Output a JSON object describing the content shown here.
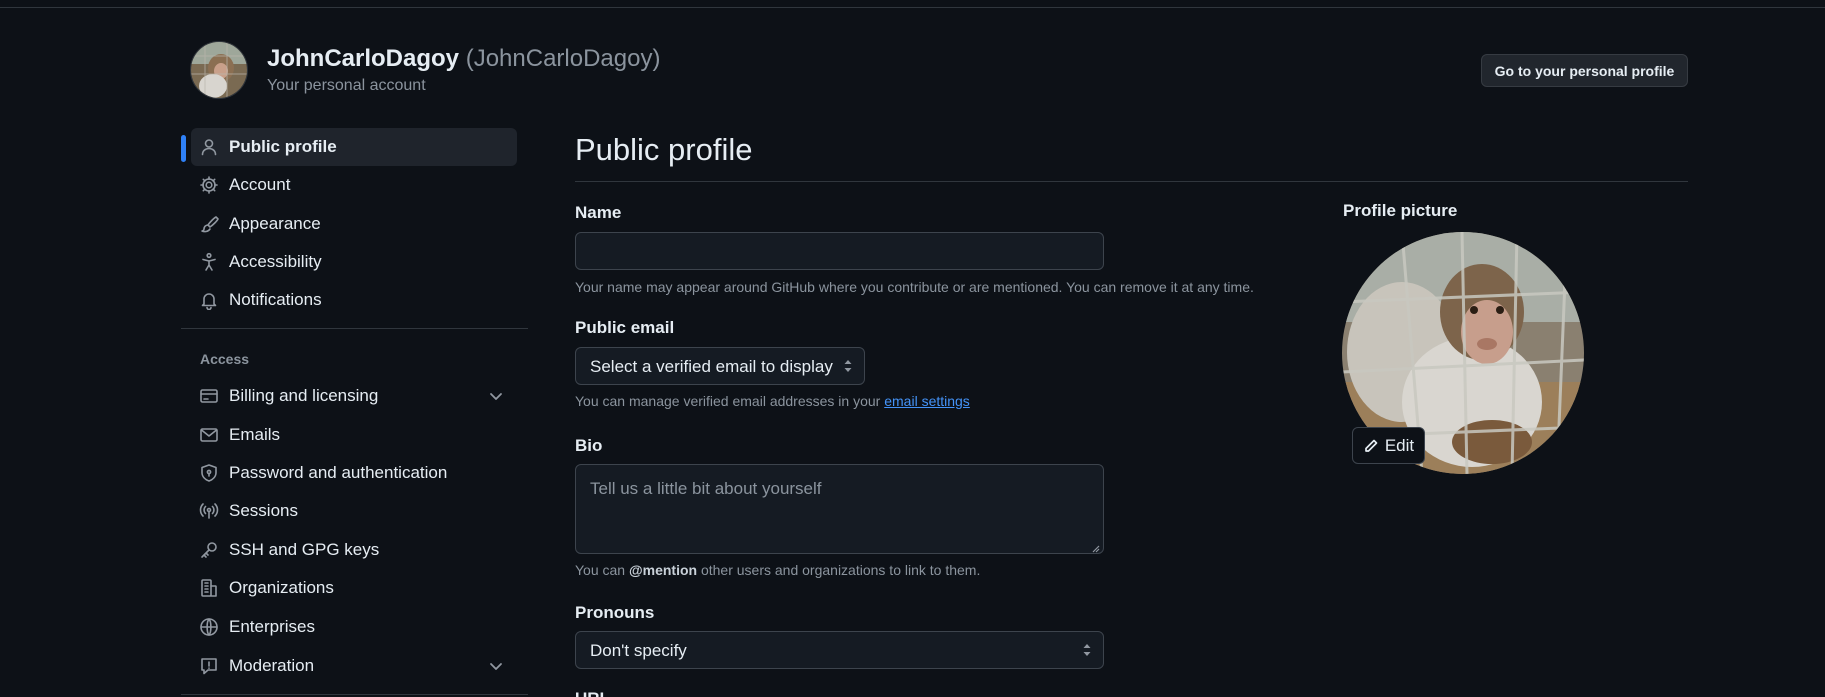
{
  "header": {
    "display_name": "JohnCarloDagoy",
    "login": "(JohnCarloDagoy)",
    "subtitle": "Your personal account",
    "go_to_profile_label": "Go to your personal profile"
  },
  "sidebar": {
    "items": [
      {
        "label": "Public profile",
        "icon": "person-icon",
        "active": true
      },
      {
        "label": "Account",
        "icon": "gear-icon"
      },
      {
        "label": "Appearance",
        "icon": "paintbrush-icon"
      },
      {
        "label": "Accessibility",
        "icon": "accessibility-icon"
      },
      {
        "label": "Notifications",
        "icon": "bell-icon"
      }
    ],
    "access_heading": "Access",
    "access_items": [
      {
        "label": "Billing and licensing",
        "icon": "credit-card-icon",
        "expandable": true
      },
      {
        "label": "Emails",
        "icon": "mail-icon"
      },
      {
        "label": "Password and authentication",
        "icon": "shield-lock-icon"
      },
      {
        "label": "Sessions",
        "icon": "broadcast-icon"
      },
      {
        "label": "SSH and GPG keys",
        "icon": "key-icon"
      },
      {
        "label": "Organizations",
        "icon": "organization-icon"
      },
      {
        "label": "Enterprises",
        "icon": "globe-icon"
      },
      {
        "label": "Moderation",
        "icon": "report-icon",
        "expandable": true
      }
    ]
  },
  "main": {
    "title": "Public profile",
    "name": {
      "label": "Name",
      "value": "",
      "note": "Your name may appear around GitHub where you contribute or are mentioned. You can remove it at any time."
    },
    "public_email": {
      "label": "Public email",
      "selected": "Select a verified email to display",
      "note_prefix": "You can manage verified email addresses in your",
      "note_link": "email settings"
    },
    "bio": {
      "label": "Bio",
      "placeholder": "Tell us a little bit about yourself",
      "note_prefix": "You can",
      "note_mention": "@mention",
      "note_suffix": "other users and organizations to link to them."
    },
    "pronouns": {
      "label": "Pronouns",
      "selected": "Don't specify"
    },
    "next_label_partial": "URL"
  },
  "profile_picture": {
    "label": "Profile picture",
    "edit_label": "Edit"
  },
  "colors": {
    "background": "#0d1117",
    "accent": "#2f81f7",
    "link": "#4493f8",
    "muted_text": "#8b949e"
  }
}
